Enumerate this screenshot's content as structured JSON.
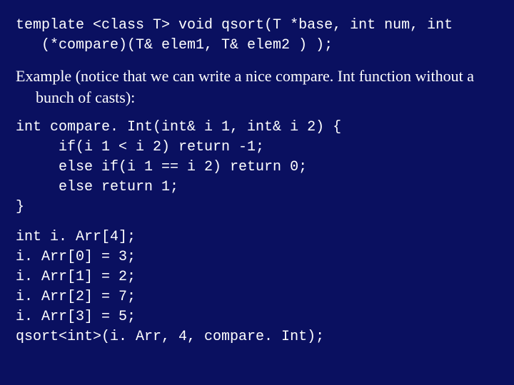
{
  "slide": {
    "code_block_1": "template <class T> void qsort(T *base, int num, int\n   (*compare)(T& elem1, T& elem2 ) );",
    "prose_1": "Example (notice that we can write a nice compare. Int function without a bunch of casts):",
    "code_block_2": "int compare. Int(int& i 1, int& i 2) {\n     if(i 1 < i 2) return -1;\n     else if(i 1 == i 2) return 0;\n     else return 1;\n}",
    "code_block_3": "int i. Arr[4];\ni. Arr[0] = 3;\ni. Arr[1] = 2;\ni. Arr[2] = 7;\ni. Arr[3] = 5;\nqsort<int>(i. Arr, 4, compare. Int);"
  }
}
